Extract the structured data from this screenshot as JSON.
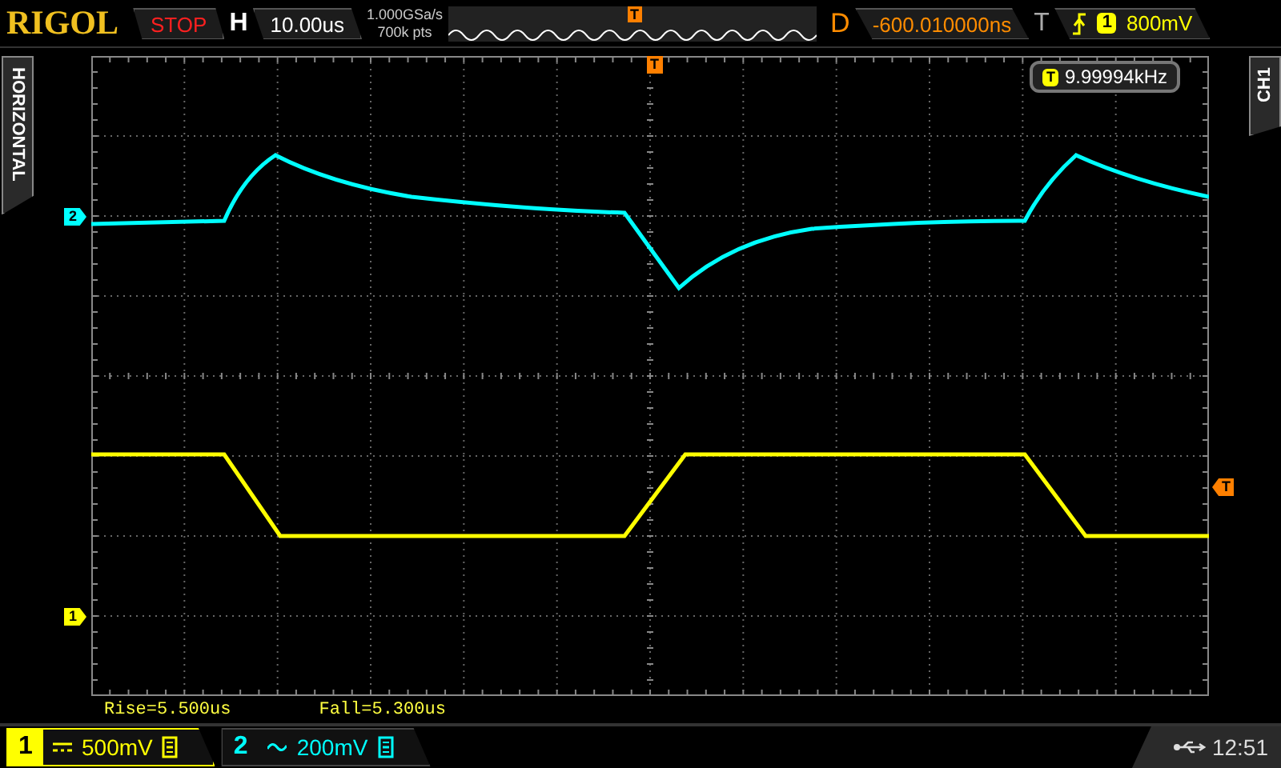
{
  "top_bar": {
    "logo": "RIGOL",
    "run_state": "STOP",
    "horizontal_label": "H",
    "timebase": "10.00us",
    "sample_rate": "1.000GSa/s",
    "memory_depth": "700k pts",
    "trigger_position_marker": "T",
    "delay_label": "D",
    "delay": "-600.010000ns",
    "trigger_label": "T",
    "trigger_source": "1",
    "trigger_level": "800mV"
  },
  "left_tab": "HORIZONTAL",
  "right_tab": "CH1",
  "display": {
    "frequency_counter": {
      "icon_label": "T",
      "value": "9.99994kHz"
    },
    "trigger_position_marker": "T",
    "trigger_level_marker": "T",
    "channel_markers": [
      {
        "label": "2",
        "color": "#00ffff"
      },
      {
        "label": "1",
        "color": "#ffff00"
      }
    ]
  },
  "measurements": [
    "Rise=5.500us",
    "Fall=5.300us"
  ],
  "channels": [
    {
      "number": "1",
      "kind": "dc",
      "scale": "500mV",
      "selected": true,
      "color": "#ffff00"
    },
    {
      "number": "2",
      "kind": "ac",
      "scale": "200mV",
      "selected": false,
      "color": "#00ffff"
    }
  ],
  "status": {
    "time": "12:51"
  }
}
